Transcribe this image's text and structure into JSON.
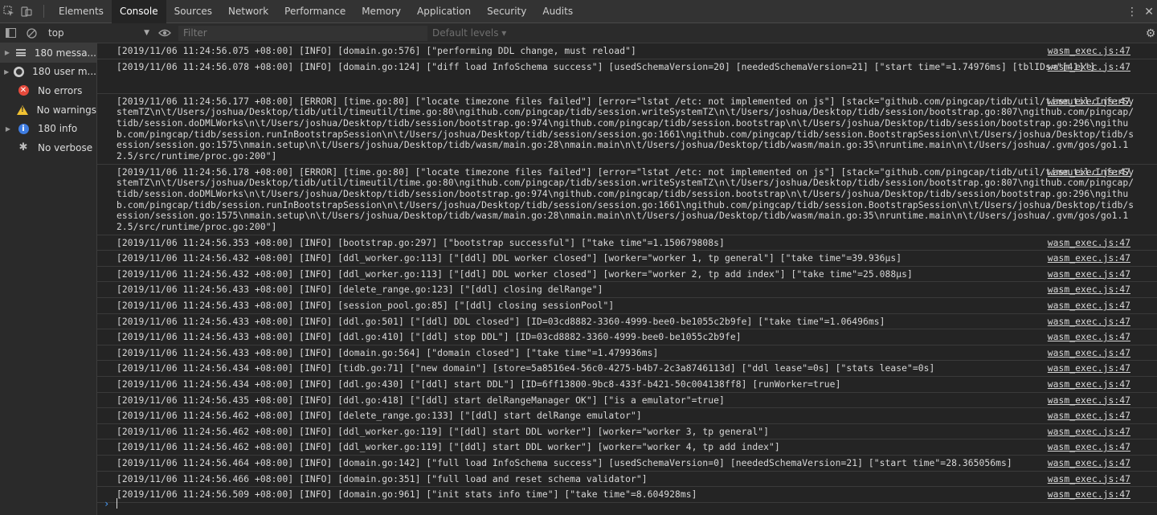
{
  "tabs": [
    {
      "label": "Elements",
      "active": false
    },
    {
      "label": "Console",
      "active": true
    },
    {
      "label": "Sources",
      "active": false
    },
    {
      "label": "Network",
      "active": false
    },
    {
      "label": "Performance",
      "active": false
    },
    {
      "label": "Memory",
      "active": false
    },
    {
      "label": "Application",
      "active": false
    },
    {
      "label": "Security",
      "active": false
    },
    {
      "label": "Audits",
      "active": false
    }
  ],
  "toolbar": {
    "context": "top",
    "filter_placeholder": "Filter",
    "levels": "Default levels ▾"
  },
  "sidebar": [
    {
      "label": "180 messa...",
      "icon": "list-icon"
    },
    {
      "label": "180 user m...",
      "icon": "user-icon"
    },
    {
      "label": "No errors",
      "icon": "error-icon"
    },
    {
      "label": "No warnings",
      "icon": "warning-icon"
    },
    {
      "label": "180 info",
      "icon": "info-icon"
    },
    {
      "label": "No verbose",
      "icon": "bug-icon"
    }
  ],
  "colors": {
    "accent": "#4aa0ff",
    "error": "#e64a3c",
    "warning": "#f1c232",
    "info": "#3f7de2"
  },
  "log": [
    {
      "text": "[2019/11/06 11:24:56.075 +08:00] [INFO] [domain.go:576] [\"performing DDL change, must reload\"]",
      "source": "wasm_exec.js:47",
      "lines": 1
    },
    {
      "text": "[2019/11/06 11:24:56.078 +08:00] [INFO] [domain.go:124] [\"diff load InfoSchema success\"] [usedSchemaVersion=20] [neededSchemaVersion=21] [\"start time\"=1.74976ms] [tblIDs=\"[41]\"]",
      "source": "wasm_exec.js:47",
      "lines": 2
    },
    {
      "text": "[2019/11/06 11:24:56.177 +08:00] [ERROR] [time.go:80] [\"locate timezone files failed\"] [error=\"lstat /etc: not implemented on js\"] [stack=\"github.com/pingcap/tidb/util/timeutil.InferSystemTZ\\n\\t/Users/joshua/Desktop/tidb/util/timeutil/time.go:80\\ngithub.com/pingcap/tidb/session.writeSystemTZ\\n\\t/Users/joshua/Desktop/tidb/session/bootstrap.go:807\\ngithub.com/pingcap/tidb/session.doDMLWorks\\n\\t/Users/joshua/Desktop/tidb/session/bootstrap.go:974\\ngithub.com/pingcap/tidb/session.bootstrap\\n\\t/Users/joshua/Desktop/tidb/session/bootstrap.go:296\\ngithub.com/pingcap/tidb/session.runInBootstrapSession\\n\\t/Users/joshua/Desktop/tidb/session/session.go:1661\\ngithub.com/pingcap/tidb/session.BootstrapSession\\n\\t/Users/joshua/Desktop/tidb/session/session.go:1575\\nmain.setup\\n\\t/Users/joshua/Desktop/tidb/wasm/main.go:28\\nmain.main\\n\\t/Users/joshua/Desktop/tidb/wasm/main.go:35\\nruntime.main\\n\\t/Users/joshua/.gvm/gos/go1.12.5/src/runtime/proc.go:200\"]",
      "source": "wasm_exec.js:47",
      "lines": 6
    },
    {
      "text": "[2019/11/06 11:24:56.178 +08:00] [ERROR] [time.go:80] [\"locate timezone files failed\"] [error=\"lstat /etc: not implemented on js\"] [stack=\"github.com/pingcap/tidb/util/timeutil.InferSystemTZ\\n\\t/Users/joshua/Desktop/tidb/util/timeutil/time.go:80\\ngithub.com/pingcap/tidb/session.writeSystemTZ\\n\\t/Users/joshua/Desktop/tidb/session/bootstrap.go:807\\ngithub.com/pingcap/tidb/session.doDMLWorks\\n\\t/Users/joshua/Desktop/tidb/session/bootstrap.go:974\\ngithub.com/pingcap/tidb/session.bootstrap\\n\\t/Users/joshua/Desktop/tidb/session/bootstrap.go:296\\ngithub.com/pingcap/tidb/session.runInBootstrapSession\\n\\t/Users/joshua/Desktop/tidb/session/session.go:1661\\ngithub.com/pingcap/tidb/session.BootstrapSession\\n\\t/Users/joshua/Desktop/tidb/session/session.go:1575\\nmain.setup\\n\\t/Users/joshua/Desktop/tidb/wasm/main.go:28\\nmain.main\\n\\t/Users/joshua/Desktop/tidb/wasm/main.go:35\\nruntime.main\\n\\t/Users/joshua/.gvm/gos/go1.12.5/src/runtime/proc.go:200\"]",
      "source": "wasm_exec.js:47",
      "lines": 6
    },
    {
      "text": "[2019/11/06 11:24:56.353 +08:00] [INFO] [bootstrap.go:297] [\"bootstrap successful\"] [\"take time\"=1.150679808s]",
      "source": "wasm_exec.js:47",
      "lines": 1
    },
    {
      "text": "[2019/11/06 11:24:56.432 +08:00] [INFO] [ddl_worker.go:113] [\"[ddl] DDL worker closed\"] [worker=\"worker 1, tp general\"] [\"take time\"=39.936µs]",
      "source": "wasm_exec.js:47",
      "lines": 1
    },
    {
      "text": "[2019/11/06 11:24:56.432 +08:00] [INFO] [ddl_worker.go:113] [\"[ddl] DDL worker closed\"] [worker=\"worker 2, tp add index\"] [\"take time\"=25.088µs]",
      "source": "wasm_exec.js:47",
      "lines": 1
    },
    {
      "text": "[2019/11/06 11:24:56.433 +08:00] [INFO] [delete_range.go:123] [\"[ddl] closing delRange\"]",
      "source": "wasm_exec.js:47",
      "lines": 1
    },
    {
      "text": "[2019/11/06 11:24:56.433 +08:00] [INFO] [session_pool.go:85] [\"[ddl] closing sessionPool\"]",
      "source": "wasm_exec.js:47",
      "lines": 1
    },
    {
      "text": "[2019/11/06 11:24:56.433 +08:00] [INFO] [ddl.go:501] [\"[ddl] DDL closed\"] [ID=03cd8882-3360-4999-bee0-be1055c2b9fe] [\"take time\"=1.06496ms]",
      "source": "wasm_exec.js:47",
      "lines": 1
    },
    {
      "text": "[2019/11/06 11:24:56.433 +08:00] [INFO] [ddl.go:410] [\"[ddl] stop DDL\"] [ID=03cd8882-3360-4999-bee0-be1055c2b9fe]",
      "source": "wasm_exec.js:47",
      "lines": 1
    },
    {
      "text": "[2019/11/06 11:24:56.433 +08:00] [INFO] [domain.go:564] [\"domain closed\"] [\"take time\"=1.479936ms]",
      "source": "wasm_exec.js:47",
      "lines": 1
    },
    {
      "text": "[2019/11/06 11:24:56.434 +08:00] [INFO] [tidb.go:71] [\"new domain\"] [store=5a8516e4-56c0-4275-b4b7-2c3a8746113d] [\"ddl lease\"=0s] [\"stats lease\"=0s]",
      "source": "wasm_exec.js:47",
      "lines": 1
    },
    {
      "text": "[2019/11/06 11:24:56.434 +08:00] [INFO] [ddl.go:430] [\"[ddl] start DDL\"] [ID=6ff13800-9bc8-433f-b421-50c004138ff8] [runWorker=true]",
      "source": "wasm_exec.js:47",
      "lines": 1
    },
    {
      "text": "[2019/11/06 11:24:56.435 +08:00] [INFO] [ddl.go:418] [\"[ddl] start delRangeManager OK\"] [\"is a emulator\"=true]",
      "source": "wasm_exec.js:47",
      "lines": 1
    },
    {
      "text": "[2019/11/06 11:24:56.462 +08:00] [INFO] [delete_range.go:133] [\"[ddl] start delRange emulator\"]",
      "source": "wasm_exec.js:47",
      "lines": 1
    },
    {
      "text": "[2019/11/06 11:24:56.462 +08:00] [INFO] [ddl_worker.go:119] [\"[ddl] start DDL worker\"] [worker=\"worker 3, tp general\"]",
      "source": "wasm_exec.js:47",
      "lines": 1
    },
    {
      "text": "[2019/11/06 11:24:56.462 +08:00] [INFO] [ddl_worker.go:119] [\"[ddl] start DDL worker\"] [worker=\"worker 4, tp add index\"]",
      "source": "wasm_exec.js:47",
      "lines": 1
    },
    {
      "text": "[2019/11/06 11:24:56.464 +08:00] [INFO] [domain.go:142] [\"full load InfoSchema success\"] [usedSchemaVersion=0] [neededSchemaVersion=21] [\"start time\"=28.365056ms]",
      "source": "wasm_exec.js:47",
      "lines": 1
    },
    {
      "text": "[2019/11/06 11:24:56.466 +08:00] [INFO] [domain.go:351] [\"full load and reset schema validator\"]",
      "source": "wasm_exec.js:47",
      "lines": 1
    },
    {
      "text": "[2019/11/06 11:24:56.509 +08:00] [INFO] [domain.go:961] [\"init stats info time\"] [\"take time\"=8.604928ms]",
      "source": "wasm_exec.js:47",
      "lines": 1
    }
  ],
  "prompt": "›"
}
